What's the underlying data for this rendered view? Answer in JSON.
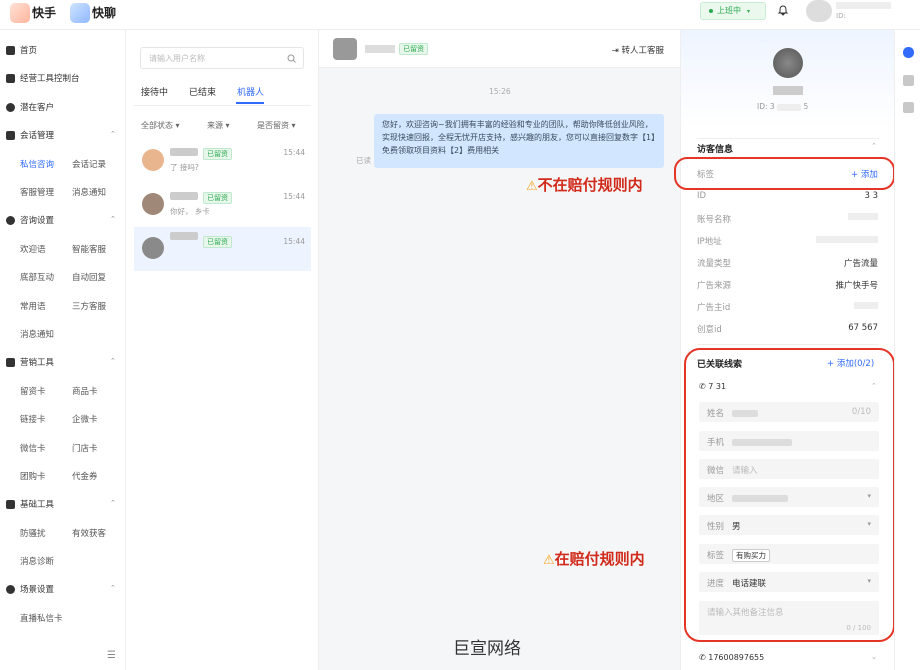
{
  "app": {
    "brand1": "快手",
    "brand2": "快聊",
    "status": "上班中",
    "user_id_prefix": "ID:"
  },
  "sidebar": {
    "home": "首页",
    "workbench": "经营工具控制台",
    "prospects": "潜在客户",
    "conversation_mgmt": "会话管理",
    "private_consult": "私信咨询",
    "session_records": "会话记录",
    "service_mgmt": "客服管理",
    "message_notify": "消息通知",
    "consult_settings": "咨询设置",
    "welcome": "欢迎语",
    "smart_service": "智能客服",
    "bottom_interact": "底部互动",
    "auto_reply": "自动回复",
    "common_phrases": "常用语",
    "third_party": "三方客服",
    "msg_notify": "消息通知",
    "marketing_tools": "营销工具",
    "lead_card": "留资卡",
    "product_card": "商品卡",
    "link_card": "链接卡",
    "wecom_card": "企微卡",
    "wechat_card": "微信卡",
    "store_card": "门店卡",
    "group_buy_card": "团购卡",
    "coupon": "代金券",
    "basic_tools": "基础工具",
    "anti_harass": "防骚扰",
    "valid_leads": "有效获客",
    "msg_diagnosis": "消息诊断",
    "scene_settings": "场景设置",
    "live_dm_card": "直播私信卡"
  },
  "conv_list": {
    "search_placeholder": "请输入用户名称",
    "tabs": [
      "接待中",
      "已结束",
      "机器人"
    ],
    "filters": [
      "全部状态",
      "来源",
      "是否留资"
    ],
    "items": [
      {
        "badge": "已留资",
        "time": "15:44",
        "preview": "了          接吗?",
        "avatar_color": "#e8b58f"
      },
      {
        "badge": "已留资",
        "time": "15:44",
        "preview": "你好，               乡卡",
        "avatar_color": "#a08878"
      },
      {
        "badge": "已留资",
        "time": "15:44",
        "preview": "",
        "avatar_color": "#8a8a8a"
      }
    ]
  },
  "chat": {
    "header_badge": "已留资",
    "transfer": "转人工客服",
    "time": "15:26",
    "message": "您好，欢迎咨询~我们拥有丰富的经验和专业的团队，帮助你降低创业风险，实现快速回报，全程无忧开店支持，感兴趣的朋友，您可以直接回复数字【1】免费领取项目资料【2】费用相关",
    "read": "已读",
    "warn_top": "不在赔付规则内",
    "warn_bottom": "在赔付规则内",
    "watermark": "巨宣网络"
  },
  "visitor": {
    "id_label": "ID: 3",
    "id_suffix": "5",
    "section_title": "访客信息",
    "tag_label": "标签",
    "add": "+ 添加",
    "rows": [
      {
        "label": "ID",
        "value": "3          3"
      },
      {
        "label": "账号名称",
        "value": "    "
      },
      {
        "label": "IP地址",
        "value": ""
      },
      {
        "label": "流量类型",
        "value": "广告流量"
      },
      {
        "label": "广告来源",
        "value": "推广快手号"
      },
      {
        "label": "广告主id",
        "value": ""
      },
      {
        "label": "创意id",
        "value": "67         567"
      }
    ]
  },
  "leads": {
    "title": "已关联线索",
    "add": "+ 添加(0/2)",
    "lead_id": "7          31",
    "fields": [
      {
        "label": "姓名",
        "counter": "0/10"
      },
      {
        "label": "手机"
      },
      {
        "label": "微信",
        "placeholder": "请输入"
      },
      {
        "label": "地区"
      },
      {
        "label": "性别",
        "value": "男"
      },
      {
        "label": "标签",
        "chip": "有购买力"
      },
      {
        "label": "进度",
        "value": "电话建联"
      }
    ],
    "remark_placeholder": "请输入其他备注信息",
    "remark_counter": "0 / 100",
    "phone": "17600897655"
  },
  "colors": {
    "accent": "#326bfb",
    "warn": "#d12a1a",
    "success": "#2bab4f"
  }
}
